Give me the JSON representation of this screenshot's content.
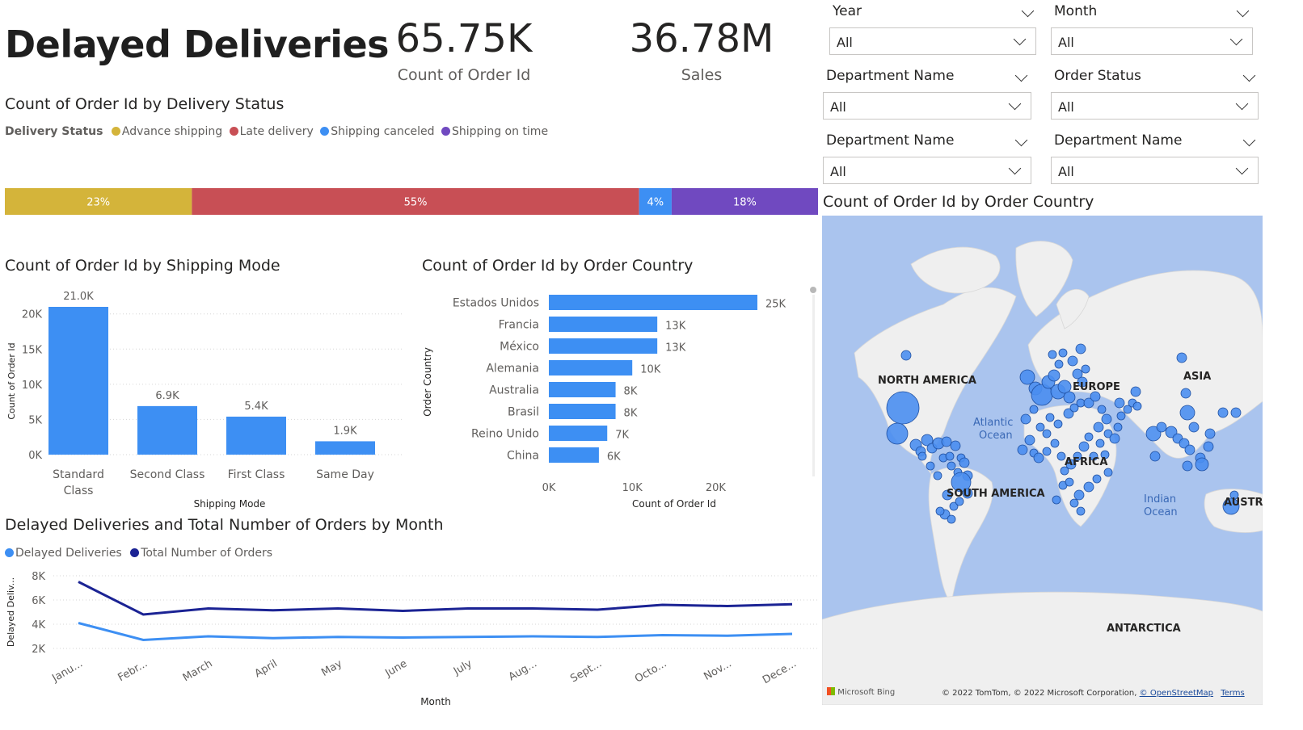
{
  "page_title": "Delayed Deliveries",
  "kpis": [
    {
      "value": "65.75K",
      "label": "Count of Order Id"
    },
    {
      "value": "36.78M",
      "label": "Sales"
    }
  ],
  "slicers": [
    {
      "header": "Year",
      "value": "All"
    },
    {
      "header": "Month",
      "value": "All"
    },
    {
      "header": "Department Name",
      "value": "All"
    },
    {
      "header": "Order Status",
      "value": "All"
    },
    {
      "header": "Department Name",
      "value": "All"
    },
    {
      "header": "Department Name",
      "value": "All"
    }
  ],
  "colors": {
    "advance": "#d4b43a",
    "late": "#c84f55",
    "canceled": "#3d8ff3",
    "ontime": "#7049c0",
    "bar": "#3d8ff3",
    "dark_line": "#1b2394",
    "light_line": "#3d8ff3",
    "map_water": "#aac4ee",
    "map_land": "#efefef"
  },
  "delivery_status": {
    "title": "Count of Order Id by Delivery Status",
    "legend_title": "Delivery Status",
    "chart_data": {
      "type": "bar",
      "orientation": "100% stacked horizontal",
      "series": [
        {
          "name": "Advance shipping",
          "value": 23,
          "label": "23%"
        },
        {
          "name": "Late delivery",
          "value": 55,
          "label": "55%"
        },
        {
          "name": "Shipping canceled",
          "value": 4,
          "label": "4%"
        },
        {
          "name": "Shipping on time",
          "value": 18,
          "label": "18%"
        }
      ]
    }
  },
  "shipping_mode": {
    "title": "Count of Order Id by Shipping Mode",
    "chart_data": {
      "type": "bar",
      "categories": [
        "Standard Class",
        "Second Class",
        "First Class",
        "Same Day"
      ],
      "category_lines": [
        [
          "Standard",
          "Class"
        ],
        [
          "Second Class"
        ],
        [
          "First Class"
        ],
        [
          "Same Day"
        ]
      ],
      "values": [
        21000,
        6900,
        5400,
        1900
      ],
      "data_labels": [
        "21.0K",
        "6.9K",
        "5.4K",
        "1.9K"
      ],
      "xlabel": "Shipping Mode",
      "ylabel": "Count of Order Id",
      "ylim": [
        0,
        21000
      ],
      "yticks": [
        {
          "v": 0,
          "t": "0K"
        },
        {
          "v": 5000,
          "t": "5K"
        },
        {
          "v": 10000,
          "t": "10K"
        },
        {
          "v": 15000,
          "t": "15K"
        },
        {
          "v": 20000,
          "t": "20K"
        }
      ],
      "grid": true
    }
  },
  "order_country": {
    "title": "Count of Order Id by Order Country",
    "chart_data": {
      "type": "bar",
      "orientation": "horizontal",
      "categories": [
        "Estados Unidos",
        "Francia",
        "México",
        "Alemania",
        "Australia",
        "Brasil",
        "Reino Unido",
        "China"
      ],
      "values": [
        25000,
        13000,
        13000,
        10000,
        8000,
        8000,
        7000,
        6000
      ],
      "data_labels": [
        "25K",
        "13K",
        "13K",
        "10K",
        "8K",
        "8K",
        "7K",
        "6K"
      ],
      "xlabel": "Count of Order Id",
      "ylabel": "Order Country",
      "xlim": [
        0,
        25000
      ],
      "xticks": [
        {
          "v": 0,
          "t": "0K"
        },
        {
          "v": 10000,
          "t": "10K"
        },
        {
          "v": 20000,
          "t": "20K"
        }
      ]
    }
  },
  "monthly": {
    "title": "Delayed Deliveries and Total Number of Orders by Month",
    "chart_data": {
      "type": "line",
      "x": [
        "Janu...",
        "Febr...",
        "March",
        "April",
        "May",
        "June",
        "July",
        "Aug...",
        "Sept...",
        "Octo...",
        "Nov...",
        "Dece..."
      ],
      "series": [
        {
          "name": "Delayed Deliveries",
          "values": [
            4100,
            2700,
            3000,
            2850,
            2950,
            2900,
            2950,
            3000,
            2950,
            3100,
            3050,
            3200
          ]
        },
        {
          "name": "Total Number of Orders",
          "values": [
            7500,
            4800,
            5300,
            5150,
            5300,
            5100,
            5300,
            5300,
            5200,
            5600,
            5500,
            5650
          ]
        }
      ],
      "xlabel": "Month",
      "ylabel": "Delayed Deliv...",
      "ylim": [
        2000,
        8000
      ],
      "yticks": [
        {
          "v": 2000,
          "t": "2K"
        },
        {
          "v": 4000,
          "t": "4K"
        },
        {
          "v": 6000,
          "t": "6K"
        },
        {
          "v": 8000,
          "t": "8K"
        }
      ],
      "grid": true
    }
  },
  "map": {
    "title": "Count of Order Id by Order Country",
    "labels": {
      "north_america": "NORTH AMERICA",
      "europe": "EUROPE",
      "asia": "ASIA",
      "africa": "AFRICA",
      "south_america": "SOUTH AMERICA",
      "australia": "AUSTRA",
      "antarctica": "ANTARCTICA",
      "atlantic": "Atlantic\nOcean",
      "indian": "Indian\nOcean"
    },
    "brand": "Microsoft Bing",
    "attribution": "© 2022 TomTom, © 2022 Microsoft Corporation,",
    "osm_link": "© OpenStreetMap",
    "terms_link": "Terms"
  }
}
